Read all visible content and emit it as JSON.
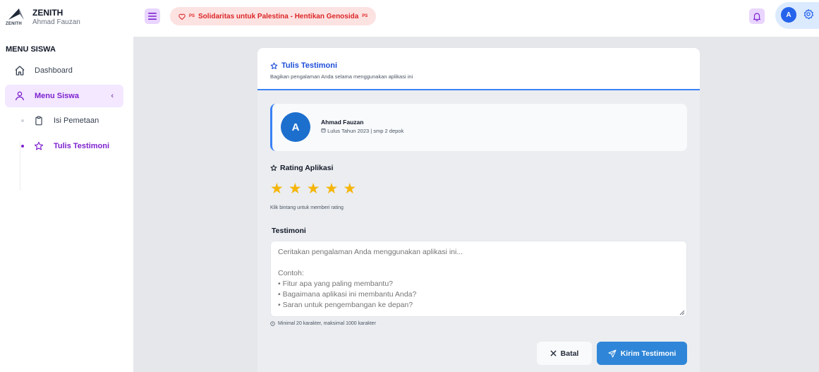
{
  "brand": {
    "title": "ZENITH",
    "logo_word": "ZENITH",
    "user": "Ahmad Fauzan"
  },
  "banner": {
    "prefix": "PS",
    "text": "Solidaritas untuk Palestina - Hentikan Genosida",
    "suffix": "PS"
  },
  "header": {
    "avatar_initial": "A"
  },
  "sidebar": {
    "heading": "MENU SISWA",
    "items": [
      {
        "label": "Dashboard",
        "icon": "home-icon"
      },
      {
        "label": "Menu Siswa",
        "icon": "user-icon",
        "chevron": "‹"
      }
    ],
    "subitems": [
      {
        "label": "Isi Pemetaan",
        "icon": "clipboard-icon"
      },
      {
        "label": "Tulis Testimoni",
        "icon": "star-outline-icon"
      }
    ]
  },
  "card": {
    "title": "Tulis Testimoni",
    "subtitle": "Bagikan pengalaman Anda selama menggunakan aplikasi ini",
    "user": {
      "initial": "A",
      "name": "Ahmad Fauzan",
      "meta": "Lulus Tahun 2023 | smp 2 depok"
    },
    "rating": {
      "title": "Rating Aplikasi",
      "value": 5,
      "max": 5,
      "hint": "Klik bintang untuk memberi rating"
    },
    "testimoni": {
      "label": "Testimoni",
      "placeholder": "Ceritakan pengalaman Anda menggunakan aplikasi ini...\n\nContoh:\n• Fitur apa yang paling membantu?\n• Bagaimana aplikasi ini membantu Anda?\n• Saran untuk pengembangan ke depan?",
      "hint": "Minimal 20 karakter, maksimal 1000 karakter"
    },
    "buttons": {
      "cancel": "Batal",
      "submit": "Kirim Testimoni"
    }
  },
  "colors": {
    "accent_purple": "#7e22ce",
    "accent_blue": "#2f86d8",
    "star": "#f5b50a",
    "banner_red": "#dc2626"
  }
}
